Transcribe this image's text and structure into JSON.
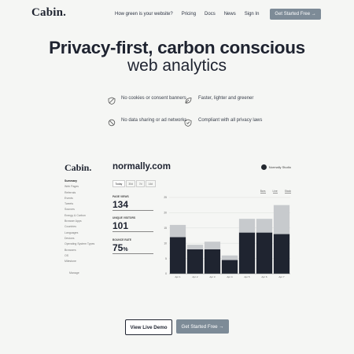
{
  "brand": "Cabin.",
  "nav": {
    "items": [
      "How green is your website?",
      "Pricing",
      "Docs",
      "News",
      "Sign In"
    ],
    "cta": "Get Started Free →"
  },
  "hero": {
    "line1": "Privacy-first, carbon conscious",
    "line2": "web analytics"
  },
  "features": [
    {
      "text": "No cookies or consent banners",
      "icon": "shield-icon"
    },
    {
      "text": "Faster, lighter and greener",
      "icon": "leaf-icon"
    },
    {
      "text": "No data sharing or ad networks",
      "icon": "block-icon"
    },
    {
      "text": "Compliant with all privacy laws",
      "icon": "shield-check-icon"
    }
  ],
  "app": {
    "brand": "Cabin.",
    "site": "normally.com",
    "studio": "Normally Studio",
    "sidebar": [
      "Summary",
      "Web Pages",
      "Referrals",
      "Events",
      "Tweets",
      "Sources",
      "Energy & Carbon",
      "Browser Apps",
      "Countries",
      "Languages",
      "Devices",
      "Operating System Types",
      "Browsers",
      "OS",
      "Milestone",
      "",
      "Manage"
    ],
    "segments": [
      "Today",
      "30d",
      "7d",
      "14d"
    ],
    "toggles": [
      "Bars",
      "Line",
      "Stack"
    ],
    "stats": [
      {
        "label": "PAGE VIEWS",
        "value": "134",
        "suffix": ""
      },
      {
        "label": "UNIQUE VISITORS",
        "value": "101",
        "suffix": ""
      },
      {
        "label": "BOUNCE RATE",
        "value": "75",
        "suffix": "%"
      }
    ]
  },
  "chart_data": {
    "type": "bar",
    "categories": [
      "Apr 1",
      "Apr 2",
      "Apr 3",
      "Apr 4",
      "Apr 5",
      "Apr 6",
      "Apr 7"
    ],
    "series": [
      {
        "values": [
          12,
          8,
          8,
          4.5,
          13.5,
          13.5,
          13
        ]
      },
      {
        "values": [
          4,
          1.5,
          2.5,
          1.5,
          4.5,
          4.5,
          9.5
        ]
      }
    ],
    "ylim": [
      0,
      25
    ],
    "yticks": [
      0,
      5,
      10,
      15,
      20,
      25
    ],
    "colors": [
      "#1f2430",
      "#c7cacd"
    ]
  },
  "buttons": {
    "demo": "View Live Demo",
    "start": "Get Started Free →"
  }
}
